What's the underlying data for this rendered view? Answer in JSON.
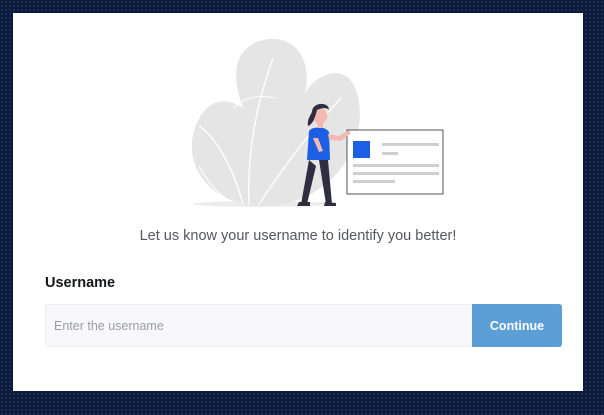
{
  "prompt": {
    "text": "Let us know your username to identify you better!"
  },
  "form": {
    "label": "Username",
    "input_placeholder": "Enter the username",
    "input_value": "",
    "submit_label": "Continue"
  },
  "illustration": {
    "icon": "woman-presenting-card-illustration"
  },
  "colors": {
    "background": "#0b1a3a",
    "card": "#ffffff",
    "accent": "#5b9fd6",
    "illustration_accent": "#1c5fe4",
    "leaf": "#e5e5e5"
  }
}
